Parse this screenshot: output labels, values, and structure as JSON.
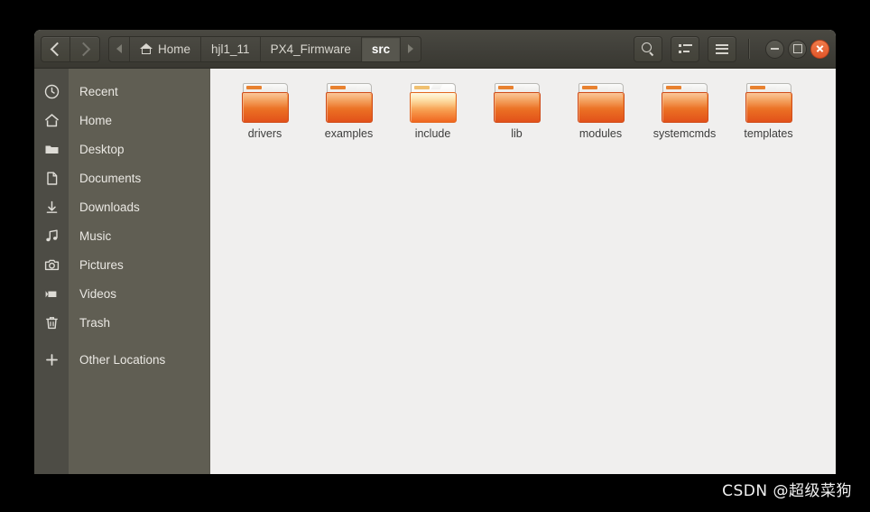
{
  "window": {
    "nav": {
      "back_label": "Back",
      "forward_label": "Forward"
    },
    "breadcrumb": {
      "prev_arrow": "◂",
      "next_arrow": "▸",
      "items": [
        {
          "label": "Home",
          "icon": "home-icon",
          "active": false
        },
        {
          "label": "hjl1_11",
          "icon": "",
          "active": false
        },
        {
          "label": "PX4_Firmware",
          "icon": "",
          "active": false
        },
        {
          "label": "src",
          "icon": "",
          "active": true
        }
      ]
    },
    "toolbar": {
      "search_label": "Search",
      "view_label": "View options",
      "menu_label": "Menu"
    },
    "controls": {
      "minimize_label": "Minimize",
      "maximize_label": "Maximize",
      "close_label": "Close"
    }
  },
  "sidebar": {
    "items": [
      {
        "label": "Recent",
        "icon": "clock-icon",
        "gap": false
      },
      {
        "label": "Home",
        "icon": "home-icon",
        "gap": false
      },
      {
        "label": "Desktop",
        "icon": "folder-icon",
        "gap": false
      },
      {
        "label": "Documents",
        "icon": "document-icon",
        "gap": false
      },
      {
        "label": "Downloads",
        "icon": "download-icon",
        "gap": false
      },
      {
        "label": "Music",
        "icon": "music-icon",
        "gap": false
      },
      {
        "label": "Pictures",
        "icon": "camera-icon",
        "gap": false
      },
      {
        "label": "Videos",
        "icon": "video-icon",
        "gap": false
      },
      {
        "label": "Trash",
        "icon": "trash-icon",
        "gap": false
      },
      {
        "label": "Other Locations",
        "icon": "plus-icon",
        "gap": true
      }
    ]
  },
  "content": {
    "items": [
      {
        "label": "drivers",
        "type": "folder",
        "highlighted": false
      },
      {
        "label": "examples",
        "type": "folder",
        "highlighted": false
      },
      {
        "label": "include",
        "type": "folder",
        "highlighted": true
      },
      {
        "label": "lib",
        "type": "folder",
        "highlighted": false
      },
      {
        "label": "modules",
        "type": "folder",
        "highlighted": false
      },
      {
        "label": "systemcmds",
        "type": "folder",
        "highlighted": false
      },
      {
        "label": "templates",
        "type": "folder",
        "highlighted": false
      }
    ]
  },
  "watermark": {
    "text": "CSDN @超级菜狗"
  },
  "colors": {
    "headerbar": "#403f39",
    "icon_rail": "#4d4c45",
    "sidebar": "#605e53",
    "content": "#f0efee",
    "accent_close": "#e2562a",
    "folder_orange": "#ea6c22",
    "desktop_background": "#000000"
  }
}
